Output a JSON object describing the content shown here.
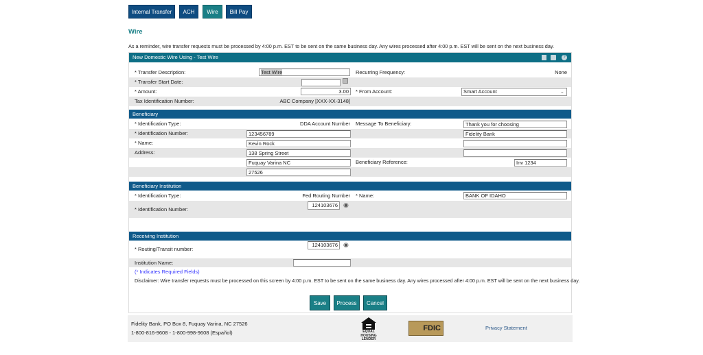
{
  "tabs": [
    {
      "label": "Internal Transfer"
    },
    {
      "label": "ACH"
    },
    {
      "label": "Wire",
      "active": true
    },
    {
      "label": "Bill Pay"
    }
  ],
  "page_title": "Wire",
  "reminder": "As a reminder, wire transfer requests must be processed by 4:00 p.m. EST to be sent on the same business day. Any wires processed after 4:00 p.m. EST will be sent on the next business day.",
  "panel": {
    "title": "New Domestic Wire Using - Test Wire",
    "icons": [
      "save-icon",
      "print-icon",
      "help-icon"
    ]
  },
  "transfer": {
    "desc_label": "* Transfer Description:",
    "desc_value": "Test Wire",
    "freq_label": "Recurring Frequency:",
    "freq_value": "None",
    "start_label": "* Transfer Start Date:",
    "start_value": "",
    "amount_label": "* Amount:",
    "amount_value": "3.00",
    "from_label": "* From Account:",
    "from_value": "Smart Account",
    "tax_label": "Tax Identification Number:",
    "tax_value": "ABC Company [XXX-XX-3148]"
  },
  "beneficiary": {
    "header": "Beneficiary",
    "idtype_label": "* Identification Type:",
    "idtype_value": "DDA Account Number",
    "idnum_label": "* Identification Number:",
    "idnum_value": "123456789",
    "name_label": "* Name:",
    "name_value": "Kevin Rock",
    "address_label": "Address:",
    "address1": "138 Spring Street",
    "address2": "Fuquay Varina NC",
    "address3": "27526",
    "msg_label": "Message To Beneficiary:",
    "msg1": "Thank you for choosing",
    "msg2": "Fidelity Bank",
    "msg3": "",
    "msg4": "",
    "ref_label": "Beneficiary Reference:",
    "ref_value": "Inv 1234"
  },
  "beneficiary_institution": {
    "header": "Beneficiary Institution",
    "idtype_label": "* Identification Type:",
    "idtype_value": "Fed Routing Number",
    "name_label": "* Name:",
    "name_value": "BANK OF IDAHO",
    "idnum_label": "* Identification Number:",
    "idnum_value": "124103676"
  },
  "receiving_institution": {
    "header": "Receiving Institution",
    "routing_label": "* Routing/Transit number:",
    "routing_value": "124103676",
    "instname_label": "Institution Name:",
    "instname_value": ""
  },
  "required_note": "(* Indicates Required Fields)",
  "disclaimer": "Disclaimer: Wire transfer requests must be processed on this screen by 4:00 p.m. EST to be sent on the same business day. Any wires processed after 4:00 p.m. EST will be sent on the next business day.",
  "buttons": {
    "save": "Save",
    "process": "Process",
    "cancel": "Cancel"
  },
  "footer": {
    "address": "Fidelity Bank, PO Box 8, Fuquay Varina, NC 27526",
    "phone": "1-800-816-9608 - 1-800-998-9608 (Español)",
    "ehl_text": "EQUAL HOUSING LENDER",
    "fdic": "FDIC",
    "privacy": "Privacy Statement"
  },
  "colors": {
    "tab_blue": "#0f4c81",
    "teal": "#1a7f86",
    "section_blue": "#0f5a8a",
    "panel_header": "#0e6f86",
    "title": "#1a7f86",
    "link": "#3a3aff"
  }
}
